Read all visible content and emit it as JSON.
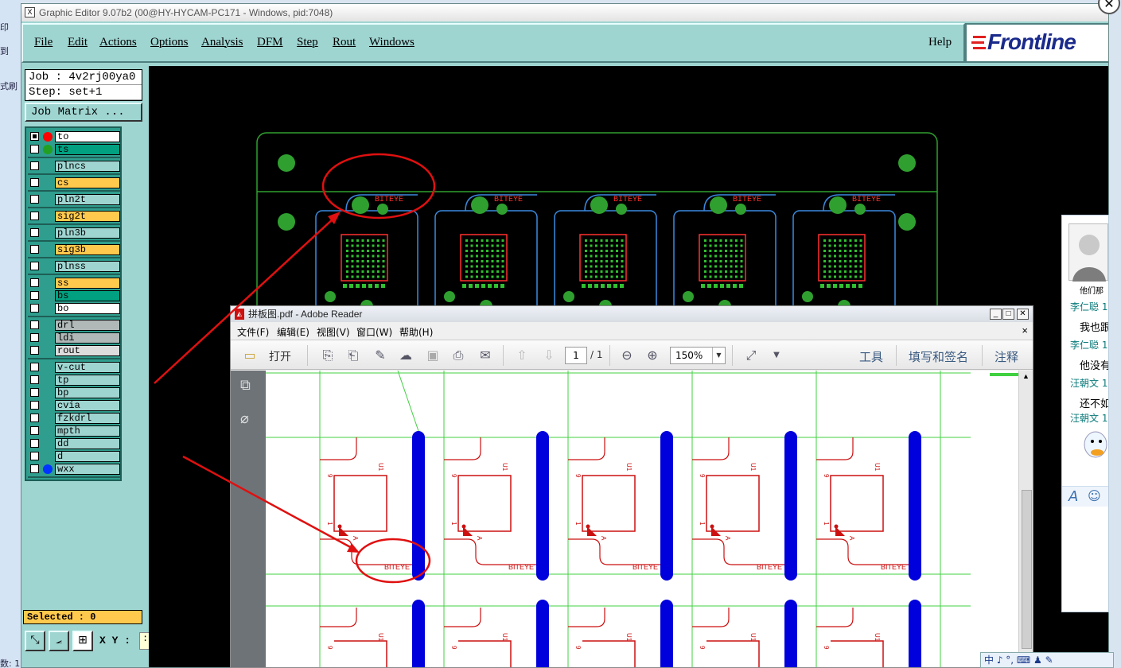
{
  "left_strip": {
    "items": [
      "印",
      "到",
      "式刷",
      "数: 1"
    ]
  },
  "ge_window": {
    "title": "Graphic Editor 9.07b2 (00@HY-HYCAM-PC171 - Windows, pid:7048)",
    "app_icon": "X",
    "menu": [
      "File",
      "Edit",
      "Actions",
      "Options",
      "Analysis",
      "DFM",
      "Step",
      "Rout",
      "Windows"
    ],
    "help": "Help",
    "logo": "Frontline",
    "job": "Job : 4v2rj00ya0",
    "step": "Step: set+1",
    "job_matrix": "Job Matrix ...",
    "selected": "Selected : 0",
    "xy_label": "X Y :",
    "xy_value": ":",
    "layers": [
      {
        "name": "to",
        "color": "#ffffff",
        "dot": "#ff0000",
        "on": true
      },
      {
        "name": "ts",
        "color": "#00a080",
        "dot": "#22a022",
        "on": false
      },
      {
        "name": "plncs",
        "color": "#9fd5d1",
        "on": false
      },
      {
        "name": "cs",
        "color": "#ffc94d",
        "on": false
      },
      {
        "name": "pln2t",
        "color": "#9fd5d1",
        "on": false
      },
      {
        "name": "sig2t",
        "color": "#ffc94d",
        "on": false
      },
      {
        "name": "pln3b",
        "color": "#9fd5d1",
        "on": false
      },
      {
        "name": "sig3b",
        "color": "#ffc94d",
        "on": false
      },
      {
        "name": "plnss",
        "color": "#9fd5d1",
        "on": false
      },
      {
        "name": "ss",
        "color": "#ffc94d",
        "on": false
      },
      {
        "name": "bs",
        "color": "#00a080",
        "on": false
      },
      {
        "name": "bo",
        "color": "#ffffff",
        "on": false
      },
      {
        "name": "drl",
        "color": "#b0b8b8",
        "on": false
      },
      {
        "name": "ldi",
        "color": "#b0b8b8",
        "on": false
      },
      {
        "name": "rout",
        "color": "#dddddd",
        "on": false
      },
      {
        "name": "v-cut",
        "color": "#9fd5d1",
        "on": false
      },
      {
        "name": "tp",
        "color": "#9fd5d1",
        "on": false
      },
      {
        "name": "bp",
        "color": "#9fd5d1",
        "on": false
      },
      {
        "name": "cvia",
        "color": "#9fd5d1",
        "on": false
      },
      {
        "name": "fzkdrl",
        "color": "#9fd5d1",
        "on": false
      },
      {
        "name": "mpth",
        "color": "#9fd5d1",
        "on": false
      },
      {
        "name": "dd",
        "color": "#9fd5d1",
        "on": false
      },
      {
        "name": "d",
        "color": "#9fd5d1",
        "on": false
      },
      {
        "name": "wxx",
        "color": "#9fd5d1",
        "dot": "#0033ff",
        "on": false
      }
    ],
    "board_label": "BITEYE"
  },
  "reader": {
    "title": "拼板图.pdf - Adobe Reader",
    "menu": [
      "文件(F)",
      "编辑(E)",
      "视图(V)",
      "窗口(W)",
      "帮助(H)"
    ],
    "open_label": "打开",
    "page_current": "1",
    "page_total": "/ 1",
    "zoom": "150%",
    "right_links": [
      "工具",
      "填写和签名",
      "注释"
    ],
    "close_doc": "×",
    "pdf_label": "BITEYE",
    "pdf_u1": "U1",
    "pdf_pin1": "1",
    "pdf_pin9": "9",
    "pdf_a": "A"
  },
  "chat": {
    "header": "他们那",
    "messages": [
      {
        "name": "李仁聪 1",
        "text": "我也跟"
      },
      {
        "name": "李仁聪 1",
        "text": "他没有"
      },
      {
        "name": "汪朝文 1",
        "text": "还不如"
      },
      {
        "name": "汪朝文 1",
        "text": ""
      }
    ]
  },
  "ime": {
    "text": "中 ♪ °, ⌨ ♟ ✎"
  },
  "colors": {
    "annotation": "#e01010",
    "board_outline": "#2fa02f",
    "pad_blue": "#0000dd"
  }
}
